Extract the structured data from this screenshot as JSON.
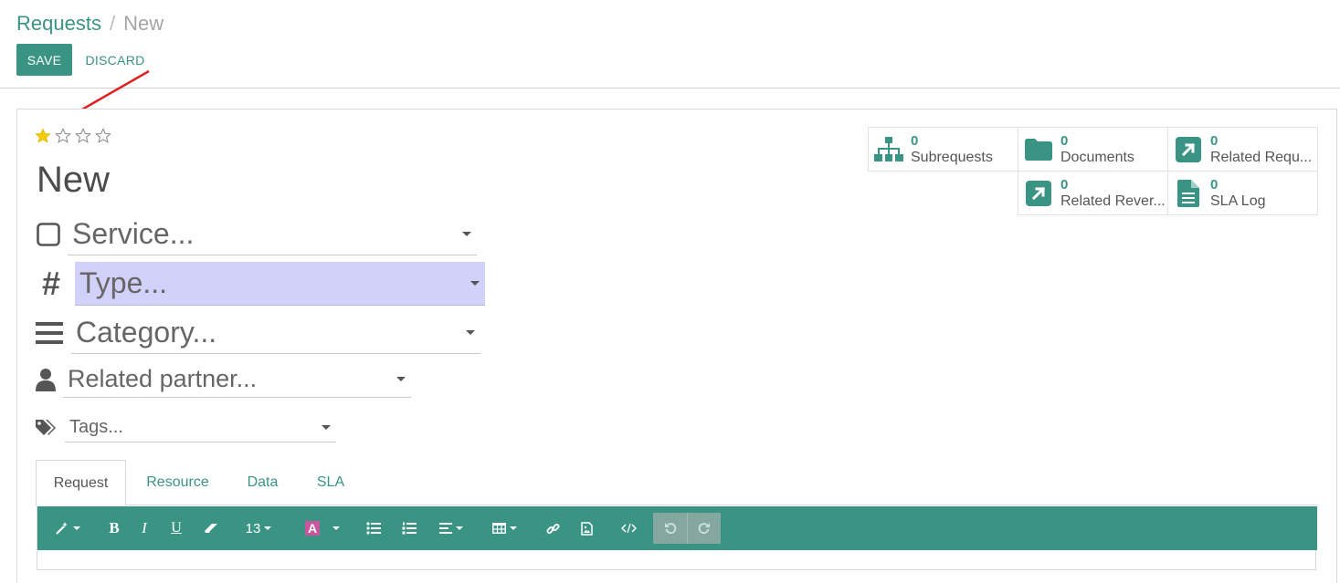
{
  "breadcrumb": {
    "parent": "Requests",
    "separator": "/",
    "current": "New"
  },
  "actions": {
    "save": "SAVE",
    "discard": "DISCARD"
  },
  "priority": {
    "value": 1,
    "max": 4
  },
  "record": {
    "title": "New"
  },
  "fields": {
    "service": {
      "placeholder": "Service...",
      "icon": "square-outline-icon"
    },
    "type": {
      "placeholder": "Type...",
      "icon": "hash-icon",
      "highlight": "#d1d1fa"
    },
    "category": {
      "placeholder": "Category...",
      "icon": "bars-icon"
    },
    "partner": {
      "placeholder": "Related partner...",
      "icon": "user-icon"
    },
    "tags": {
      "placeholder": "Tags...",
      "icon": "tags-icon"
    }
  },
  "smart_buttons": [
    {
      "count": "0",
      "label": "Subrequests",
      "icon": "sitemap-icon"
    },
    {
      "count": "0",
      "label": "Documents",
      "icon": "folder-icon"
    },
    {
      "count": "0",
      "label": "Related Requ...",
      "icon": "external-link-icon"
    },
    {
      "count": "0",
      "label": "Related Rever...",
      "icon": "external-link-icon"
    },
    {
      "count": "0",
      "label": "SLA Log",
      "icon": "file-text-icon"
    }
  ],
  "tabs": [
    {
      "label": "Request",
      "active": true
    },
    {
      "label": "Resource",
      "active": false
    },
    {
      "label": "Data",
      "active": false
    },
    {
      "label": "SLA",
      "active": false
    }
  ],
  "editor": {
    "font_size": "13",
    "toolbar_color": "#3a9484"
  },
  "colors": {
    "brand": "#3a9484",
    "star": "#f3cc00",
    "arrow": "#e02020"
  }
}
